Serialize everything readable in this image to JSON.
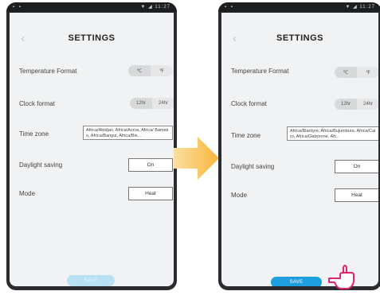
{
  "status": {
    "left": "▪ ▪",
    "right": "▼ ◢ 11:27"
  },
  "screen": {
    "title": "SETTINGS",
    "temperature": {
      "label": "Temperature Format",
      "options": [
        "℃",
        "℉"
      ]
    },
    "clock": {
      "label": "Clock format",
      "options": [
        "12hr",
        "24hr"
      ]
    },
    "timezone": {
      "label": "Time zone",
      "value_left": "Africa/Abidjan, Africa/Accra, Africa/ Bamako, Africa/Bangui, Africa/Bis...",
      "value_right": "Africa/Blantyre, Africa/Bujumbura, Africa/Cairo, Africa/Gaborone, Afr..."
    },
    "daylight": {
      "label": "Daylight saving",
      "value": "On"
    },
    "mode": {
      "label": "Mode",
      "value": "Heat"
    },
    "save_label": "SAVE"
  },
  "colors": {
    "arrow": "#f7b53b",
    "hand": "#e0246f",
    "save_active": "#1e9fe0",
    "save_disabled": "#b8e1f3"
  }
}
